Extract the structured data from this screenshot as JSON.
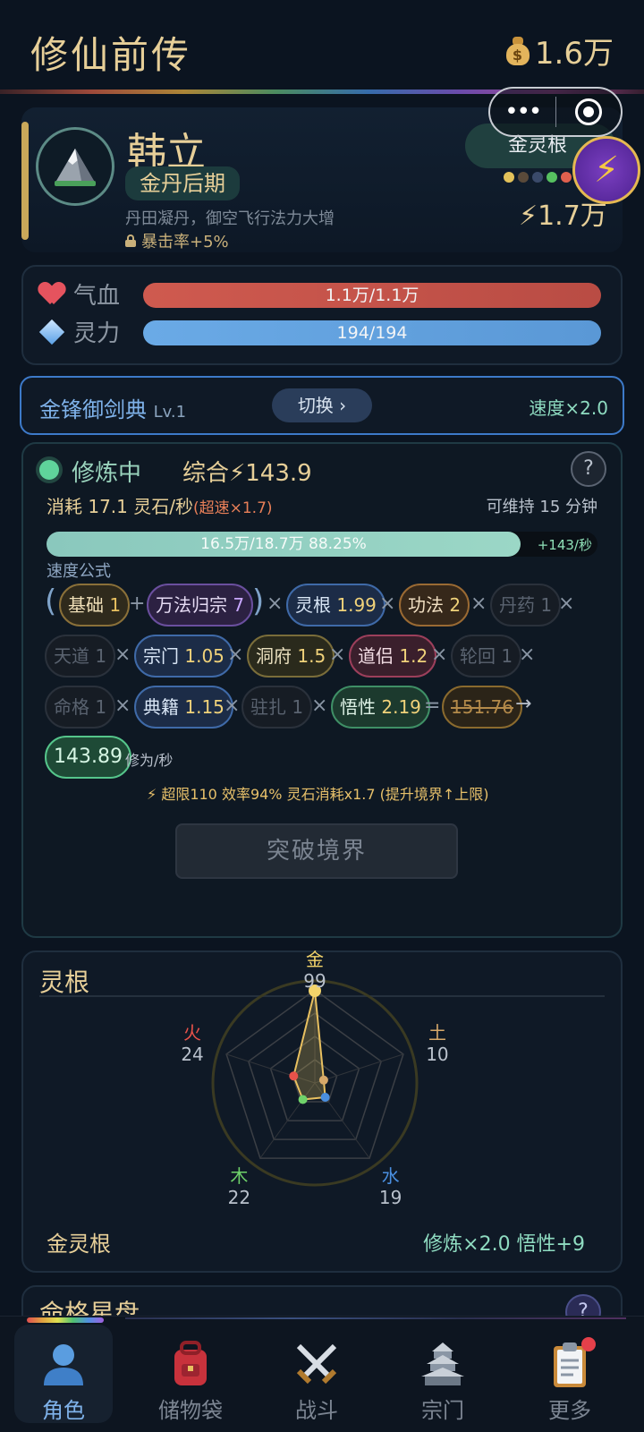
{
  "header": {
    "title": "修仙前传",
    "currency": "1.6万"
  },
  "character": {
    "name": "韩立",
    "realm": "金丹后期",
    "description": "丹田凝丹，御空飞行法力大增",
    "bonus": "暴击率+5%",
    "root_label": "金灵根",
    "power": "1.7万",
    "element_dot_colors": [
      "#e3c25a",
      "#5a4a3a",
      "#3a4a6a",
      "#56c060",
      "#e0604e"
    ]
  },
  "stats": {
    "hp_label": "气血",
    "hp_value": "1.1万/1.1万",
    "hp_fill": 1.0,
    "mp_label": "灵力",
    "mp_value": "194/194",
    "mp_fill": 1.0
  },
  "technique": {
    "name": "金锋御剑典",
    "level": "Lv.1",
    "switch_label": "切换 ›",
    "speed": "速度×2.0"
  },
  "cultivation": {
    "status": "修炼中",
    "total": "综合⚡143.9",
    "help": "?",
    "consume": "消耗 17.1 灵石/秒",
    "overspeed": "(超速×1.7)",
    "sustain": "可维持 15 分钟",
    "progress_text": "16.5万/18.7万  88.25%",
    "progress_fraction": 0.8825,
    "rate": "+143/秒",
    "formula_label": "速度公式",
    "factors": {
      "base": {
        "name": "基础",
        "val": "1"
      },
      "wanfa": {
        "name": "万法归宗",
        "val": "7"
      },
      "root": {
        "name": "灵根",
        "val": "1.99"
      },
      "skill": {
        "name": "功法",
        "val": "2"
      },
      "pill": {
        "name": "丹药",
        "val": "1"
      },
      "heaven": {
        "name": "天道",
        "val": "1"
      },
      "sect": {
        "name": "宗门",
        "val": "1.05"
      },
      "cave": {
        "name": "洞府",
        "val": "1.5"
      },
      "partner": {
        "name": "道侣",
        "val": "1.2"
      },
      "rebirth": {
        "name": "轮回",
        "val": "1"
      },
      "fate": {
        "name": "命格",
        "val": "1"
      },
      "book": {
        "name": "典籍",
        "val": "1.15"
      },
      "station": {
        "name": "驻扎",
        "val": "1"
      },
      "insight": {
        "name": "悟性",
        "val": "2.19"
      }
    },
    "raw_value": "151.76",
    "result": "143.89",
    "result_unit": "修为/秒",
    "limit_note": "⚡ 超限110 效率94% 灵石消耗x1.7 (提升境界↑上限)",
    "breakthrough": "突破境界"
  },
  "spirit_root": {
    "title": "灵根",
    "elements": [
      {
        "name": "金",
        "value": "99",
        "num": 99,
        "color": "#f3d46a"
      },
      {
        "name": "土",
        "value": "10",
        "num": 10,
        "color": "#d7a96a"
      },
      {
        "name": "水",
        "value": "19",
        "num": 19,
        "color": "#4a8fe0"
      },
      {
        "name": "木",
        "value": "22",
        "num": 22,
        "color": "#6fd26a"
      },
      {
        "name": "火",
        "value": "24",
        "num": 24,
        "color": "#e8524a"
      }
    ],
    "root_name": "金灵根",
    "bonus": "修炼×2.0  悟性+9"
  },
  "next_section": {
    "title": "命格星盘",
    "help": "?"
  },
  "nav": [
    {
      "label": "角色",
      "active": true
    },
    {
      "label": "储物袋",
      "active": false
    },
    {
      "label": "战斗",
      "active": false
    },
    {
      "label": "宗门",
      "active": false
    },
    {
      "label": "更多",
      "active": false
    }
  ]
}
